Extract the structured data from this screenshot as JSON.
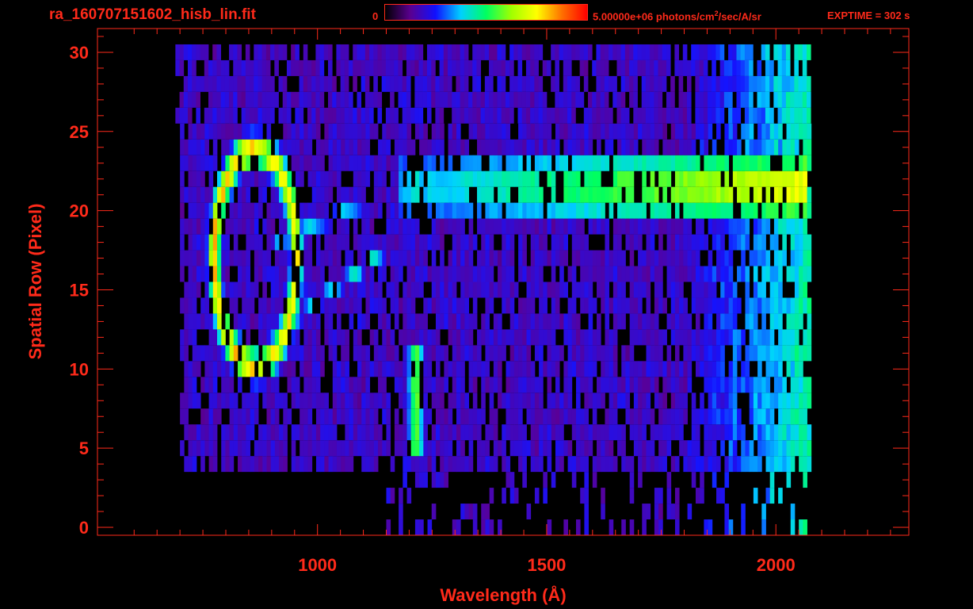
{
  "header": {
    "title": "ra_160707151602_hisb_lin.fit",
    "colorbar_min": "0",
    "colorbar_max_prefix": "5.00000e+06 photons/cm",
    "colorbar_max_sup": "2",
    "colorbar_max_suffix": "/sec/A/sr",
    "exptime": "EXPTIME = 302 s",
    "colorbar_colors": [
      "#000000",
      "#5a0090",
      "#1010ff",
      "#00d0ff",
      "#00ff60",
      "#a0ff00",
      "#ffff00",
      "#ff7000",
      "#ff0000"
    ]
  },
  "chart_data": {
    "type": "heatmap",
    "title": "ra_160707151602_hisb_lin.fit",
    "xlabel": "Wavelength (Å)",
    "ylabel": "Spatial Row (Pixel)",
    "xlim": [
      520,
      2290
    ],
    "ylim": [
      -0.5,
      31.5
    ],
    "xticks": [
      1000,
      1500,
      2000
    ],
    "yticks": [
      0,
      5,
      10,
      15,
      20,
      25,
      30
    ],
    "grid": false,
    "colorbar": {
      "min": 0,
      "max": 5000000,
      "units": "photons/cm^2/sec/A/sr"
    },
    "exptime_s": 302,
    "features": [
      {
        "name": "",
        "x_range": [
          780,
          2060
        ],
        "rows": [
          20,
          23
        ],
        "level": 0.55
      },
      {
        "name": "",
        "x_range": [
          1190,
          1230
        ],
        "rows": [
          5,
          11
        ],
        "level": 0.6
      },
      {
        "name": "",
        "x_range": [
          1190,
          1230
        ],
        "rows": [
          20,
          23
        ],
        "level": 0.5
      },
      {
        "name": "",
        "x": 800,
        "rows": [
          13,
          20
        ],
        "level": 0.75
      }
    ]
  },
  "palette": {
    "axis": "#ff2a1a",
    "background": "#000000"
  }
}
